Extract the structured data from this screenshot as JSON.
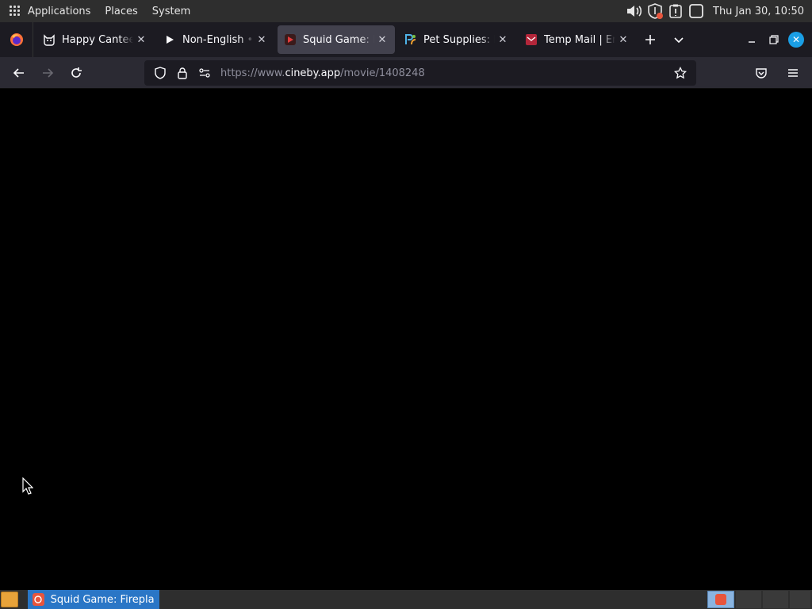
{
  "top_panel": {
    "menu": [
      "Applications",
      "Places",
      "System"
    ],
    "clock": "Thu Jan 30, 10:50"
  },
  "tabs": [
    {
      "title": "Happy Canteen",
      "favicon": "cat-face-icon",
      "active": false
    },
    {
      "title": "Non-English • free",
      "favicon": "play-icon",
      "active": false
    },
    {
      "title": "Squid Game: Fireplace",
      "favicon": "cineby-icon",
      "active": true
    },
    {
      "title": "Pet Supplies: Dog",
      "favicon": "pet-supplies-icon",
      "active": false
    },
    {
      "title": "Temp Mail | Email",
      "favicon": "temp-mail-icon",
      "active": false
    }
  ],
  "navbar": {
    "url_prefix": "https://www.",
    "url_domain": "cineby.app",
    "url_path": "/movie/1408248"
  },
  "taskbar": {
    "task_label": "Squid Game: Firepla…"
  },
  "colors": {
    "accent": "#1a9fe6",
    "taskbar_active": "#2a76c6",
    "page_background": "#000000"
  }
}
